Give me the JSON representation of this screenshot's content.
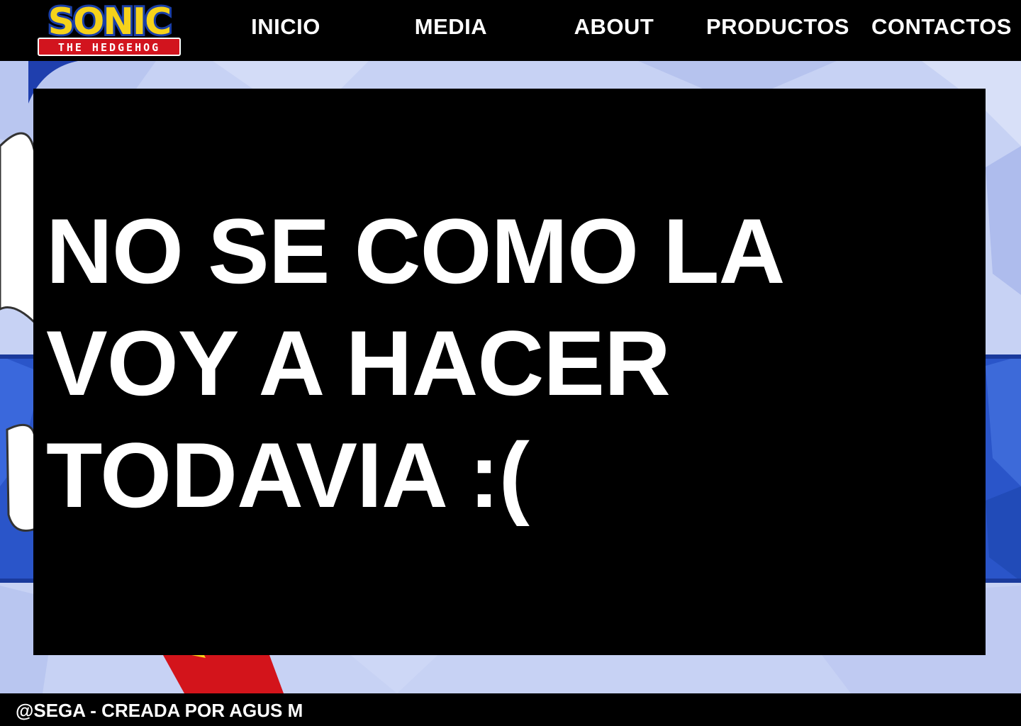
{
  "header": {
    "logo": {
      "title": "SONIC",
      "subtitle": "THE HEDGEHOG",
      "colors": {
        "title_fill": "#f6d21a",
        "title_outline": "#1a3fa8",
        "subtitle_bg": "#d2141e"
      }
    },
    "nav": [
      {
        "label": "INICIO"
      },
      {
        "label": "MEDIA"
      },
      {
        "label": "ABOUT"
      },
      {
        "label": "PRODUCTOS"
      },
      {
        "label": "CONTACTOS"
      }
    ]
  },
  "main": {
    "title_lines": [
      "NO SE COMO LA",
      "VOY A HACER",
      "TODAVIA :("
    ]
  },
  "footer": {
    "text": "@SEGA - CREADA POR AGUS M"
  },
  "colors": {
    "background": "#000000",
    "text": "#ffffff",
    "bg_art_light": "#c7d2f4",
    "bg_art_blue": "#2a55c9"
  }
}
